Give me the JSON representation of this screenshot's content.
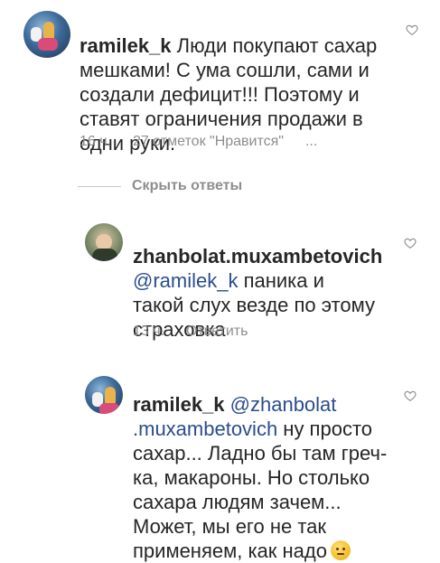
{
  "comments": [
    {
      "username": "ramilek_k",
      "text": "Люди покупают сахар\nмешками! С ума сошли, сами и\nсоздали дефицит!!! Поэтому и\nставят ограничения продажи в\nодни руки.",
      "time": "16 ч.",
      "likes": "27 отметок \"Нравится\"",
      "more": "..."
    },
    {
      "username": "zhanbolat.muxambetovich",
      "mention": "@ramilek_k",
      "text": " паника и\nтакой слух везде по этому\nстраховка",
      "time": "13 ч.",
      "reply": "Ответить"
    },
    {
      "username": "ramilek_k",
      "mention_line1": "@zhanbolat",
      "mention_line2": ".muxambetovich",
      "text_after_mention": " ну просто",
      "text": "сахар... Ладно бы там греч-\nка, макароны. Но столько\nсахара людям зачем...\nМожет, мы его не так\nприменяем, как надо",
      "emoji": "thinking-face-emoji"
    }
  ],
  "hide_replies": "Скрыть ответы",
  "icons": {
    "heart": "heart-outline-icon"
  },
  "colors": {
    "text": "#262626",
    "muted": "#8e8e8e",
    "mention": "#2a4d8f"
  }
}
